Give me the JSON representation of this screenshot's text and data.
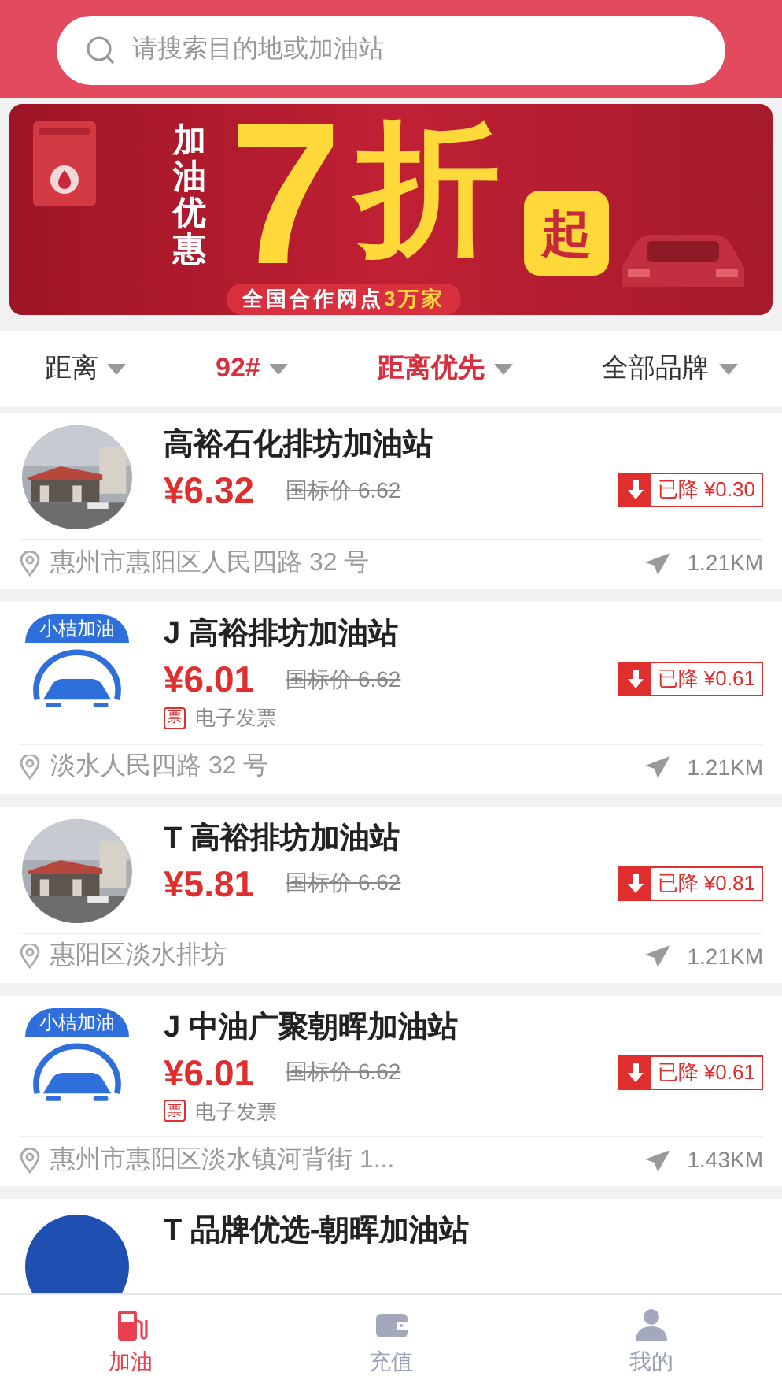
{
  "search": {
    "placeholder": "请搜索目的地或加油站"
  },
  "banner": {
    "side_text": "加油优惠",
    "big_number": "7",
    "big_word": "折",
    "badge": "起",
    "ribbon_text": "全国合作网点",
    "ribbon_highlight": "3万家"
  },
  "filters": [
    {
      "label": "距离",
      "selected": false
    },
    {
      "label": "92#",
      "selected": true
    },
    {
      "label": "距离优先",
      "selected": true
    },
    {
      "label": "全部品牌",
      "selected": false
    }
  ],
  "stations": [
    {
      "name": "高裕石化排坊加油站",
      "price": "¥6.32",
      "list_price": "国标价 6.62",
      "discount": "已降 ¥0.30",
      "address": "惠州市惠阳区人民四路 32 号",
      "distance": "1.21KM"
    },
    {
      "avatar": {
        "kind": "logo",
        "text": "小桔加油"
      },
      "name": "J 高裕排坊加油站",
      "price": "¥6.01",
      "list_price": "国标价 6.62",
      "discount": "已降 ¥0.61",
      "invoice": {
        "tag": "票",
        "label": "电子发票"
      },
      "address": "淡水人民四路 32 号",
      "distance": "1.21KM"
    },
    {
      "name": "T 高裕排坊加油站",
      "price": "¥5.81",
      "list_price": "国标价 6.62",
      "discount": "已降 ¥0.81",
      "address": "惠阳区淡水排坊",
      "distance": "1.21KM"
    },
    {
      "avatar": {
        "kind": "logo",
        "text": "小桔加油"
      },
      "name": "J 中油广聚朝晖加油站",
      "price": "¥6.01",
      "list_price": "国标价 6.62",
      "discount": "已降 ¥0.61",
      "invoice": {
        "tag": "票",
        "label": "电子发票"
      },
      "address": "惠州市惠阳区淡水镇河背街 1...",
      "distance": "1.43KM"
    },
    {
      "avatar": {
        "kind": "brand"
      },
      "name": "T 品牌优选-朝晖加油站"
    }
  ],
  "tab_bar": [
    {
      "label": "加油",
      "selected": true
    },
    {
      "label": "充值",
      "selected": false
    },
    {
      "label": "我的",
      "selected": false
    }
  ]
}
